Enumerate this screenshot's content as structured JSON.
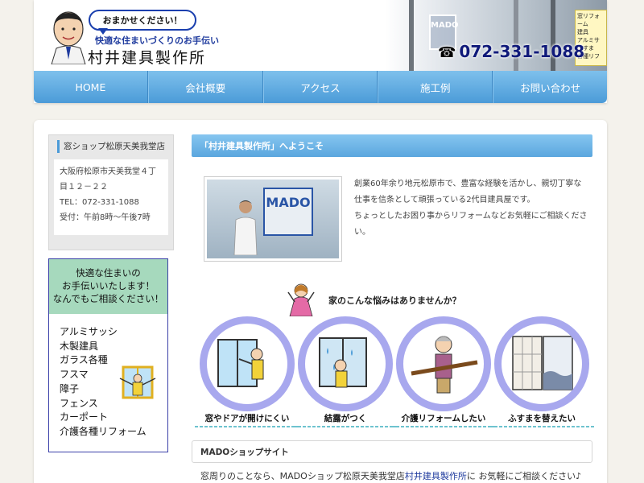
{
  "header": {
    "bubble": "おまかせください！",
    "tagline": "快適な住まいづくりのお手伝い",
    "company": "村井建具製作所",
    "phone": "072-331-1088",
    "store_sign": "MADO",
    "sign_lines": [
      "窓リフォーム",
      "建具",
      "アルミサ",
      "ふすま",
      "各種リフ"
    ]
  },
  "nav": [
    "HOME",
    "会社概要",
    "アクセス",
    "施工例",
    "お問い合わせ"
  ],
  "sidebar": {
    "shop": {
      "title": "窓ショップ松原天美我堂店",
      "address": "大阪府松原市天美我堂４丁目１２－２２",
      "tel": "TEL：072-331-1088",
      "hours": "受付：午前8時～午後7時"
    },
    "promo": {
      "heading": [
        "快適な住まいの",
        "お手伝いいたします！",
        "なんでもご相談ください！"
      ],
      "items": [
        "アルミサッシ",
        "木製建具",
        "ガラス各種",
        "フスマ",
        "障子",
        "フェンス",
        "カーポート",
        "介護各種リフォーム"
      ]
    }
  },
  "main": {
    "welcome": "「村井建具製作所」へようこそ",
    "photo_sign": "MADO",
    "intro": [
      "創業60年余り地元松原市で、豊富な経験を活かし、親切丁寧な仕事を信条として頑張っている2代目建具屋です。",
      "ちょっとしたお困り事からリフォームなどお気軽にご相談ください。"
    ],
    "concern_heading": "家のこんな悩みはありませんか？",
    "concerns": [
      "窓やドアが開けにくい",
      "結露がつく",
      "介護リフォームしたい",
      "ふすまを替えたい"
    ],
    "mado_site_title": "MADOショップサイト",
    "footer": {
      "prefix": "窓周りのことなら、MADOショップ松原天美我堂店",
      "link": "村井建具製作所",
      "suffix": "に お気軽にご相談ください♪"
    }
  },
  "colors": {
    "nav": "#4b9bd8",
    "accent": "#1f3b9e",
    "promo_head": "#a6d9bd",
    "circle_ring": "#a8a8ee"
  }
}
